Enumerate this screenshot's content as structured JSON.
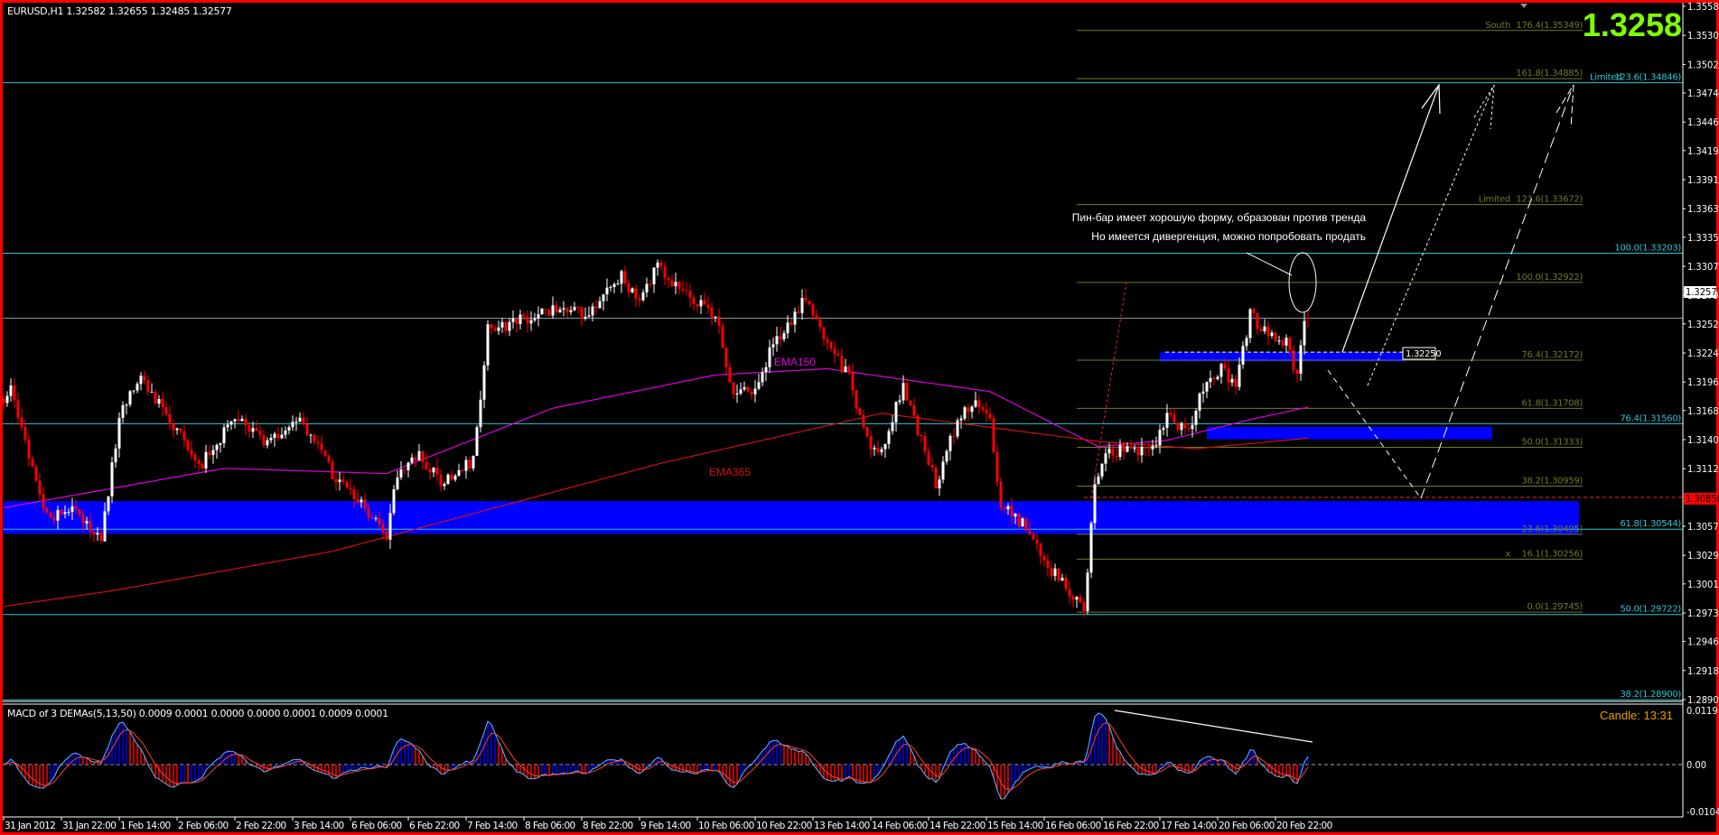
{
  "header": {
    "symbol_line": "EURUSD,H1  1.32582 1.32655 1.32485 1.32577",
    "big_price": "1.3258"
  },
  "indicator": {
    "macd_label": "MACD of 3 DEMAs(5,13,50) 0.0009 0.0001 0.0000 0.0000 0.0001 0.0009 0.0001",
    "candle_timer": "Candle:  13:31",
    "scale_labels": [
      "0.0119",
      "0.00",
      "-0.0104"
    ],
    "range": [
      -0.0104,
      0.0119
    ]
  },
  "annotation": {
    "line1": "Пин-бар имеет хорошую форму, образован против тренда",
    "line2": "Но имеется дивергенция, можно попробовать продать"
  },
  "labels": {
    "ema150": "EMA150",
    "ema365": "EMA365",
    "box_price": "1.32250",
    "current_price": "1.32577",
    "alert_price": "1.30850"
  },
  "colors": {
    "background": "#000000",
    "frame": "#ff0000",
    "bull": "#ffffff",
    "bear": "#ff0000",
    "zone": "#0000ff",
    "cyan": "#27c6d6",
    "fib": "#6b7b2b",
    "ema150": "#e000e0",
    "ema365": "#d01010",
    "big_price": "#7fff00",
    "timer": "#e8a000",
    "macd_line": "#5fb8ff",
    "signal_line": "#ff4030"
  },
  "chart_data": {
    "type": "candlestick",
    "title": "EURUSD,H1",
    "timeframe": "H1",
    "ylim": [
      1.28902,
      1.35582
    ],
    "y_ticks": [
      "1.35582",
      "1.35302",
      "1.35022",
      "1.34747",
      "1.34467",
      "1.34192",
      "1.33912",
      "1.33632",
      "1.33357",
      "1.33077",
      "1.32797",
      "1.32522",
      "1.32242",
      "1.31962",
      "1.31687",
      "1.31407",
      "1.31127",
      "1.30572",
      "1.30292",
      "1.30017",
      "1.29737",
      "1.29462",
      "1.29182",
      "1.28902"
    ],
    "x_ticks": [
      "31 Jan 2012",
      "31 Jan 22:00",
      "1 Feb 14:00",
      "2 Feb 06:00",
      "2 Feb 22:00",
      "3 Feb 14:00",
      "6 Feb 06:00",
      "6 Feb 22:00",
      "7 Feb 14:00",
      "8 Feb 06:00",
      "8 Feb 22:00",
      "9 Feb 14:00",
      "10 Feb 06:00",
      "10 Feb 22:00",
      "13 Feb 14:00",
      "14 Feb 06:00",
      "14 Feb 22:00",
      "15 Feb 14:00",
      "16 Feb 06:00",
      "16 Feb 22:00",
      "17 Feb 14:00",
      "20 Feb 06:00",
      "20 Feb 22:00"
    ],
    "bars_per_tick": 16,
    "close_path": [
      [
        0,
        1.318
      ],
      [
        2,
        1.3187
      ],
      [
        12,
        1.3065
      ],
      [
        18,
        1.3075
      ],
      [
        27,
        1.3044
      ],
      [
        32,
        1.3161
      ],
      [
        38,
        1.3203
      ],
      [
        46,
        1.3157
      ],
      [
        55,
        1.3118
      ],
      [
        64,
        1.3161
      ],
      [
        73,
        1.3135
      ],
      [
        82,
        1.3161
      ],
      [
        91,
        1.3108
      ],
      [
        100,
        1.3075
      ],
      [
        106,
        1.3044
      ],
      [
        109,
        1.311
      ],
      [
        115,
        1.3125
      ],
      [
        121,
        1.31
      ],
      [
        130,
        1.312
      ],
      [
        134,
        1.3246
      ],
      [
        143,
        1.3256
      ],
      [
        152,
        1.3267
      ],
      [
        161,
        1.3262
      ],
      [
        171,
        1.3299
      ],
      [
        176,
        1.327
      ],
      [
        181,
        1.331
      ],
      [
        188,
        1.328
      ],
      [
        197,
        1.3262
      ],
      [
        202,
        1.3182
      ],
      [
        209,
        1.319
      ],
      [
        212,
        1.3225
      ],
      [
        222,
        1.3277
      ],
      [
        228,
        1.3235
      ],
      [
        234,
        1.32
      ],
      [
        240,
        1.3128
      ],
      [
        244,
        1.314
      ],
      [
        249,
        1.3193
      ],
      [
        255,
        1.313
      ],
      [
        258,
        1.3097
      ],
      [
        264,
        1.316
      ],
      [
        269,
        1.318
      ],
      [
        273,
        1.316
      ],
      [
        276,
        1.3076
      ],
      [
        282,
        1.306
      ],
      [
        288,
        1.3023
      ],
      [
        296,
        1.299
      ],
      [
        299,
        1.2975
      ],
      [
        302,
        1.3097
      ],
      [
        305,
        1.3128
      ],
      [
        313,
        1.3132
      ],
      [
        317,
        1.3128
      ],
      [
        322,
        1.3161
      ],
      [
        328,
        1.315
      ],
      [
        332,
        1.3193
      ],
      [
        337,
        1.321
      ],
      [
        341,
        1.319
      ],
      [
        345,
        1.3261
      ],
      [
        349,
        1.3245
      ],
      [
        355,
        1.3235
      ],
      [
        358,
        1.3203
      ],
      [
        360,
        1.325
      ],
      [
        361,
        1.32577
      ]
    ],
    "last_ohlc": {
      "open": 1.32582,
      "high": 1.32655,
      "low": 1.32485,
      "close": 1.32577
    },
    "ema150_path": [
      [
        0,
        1.3075
      ],
      [
        61,
        1.3113
      ],
      [
        106,
        1.3108
      ],
      [
        152,
        1.3171
      ],
      [
        197,
        1.3203
      ],
      [
        228,
        1.3209
      ],
      [
        273,
        1.3187
      ],
      [
        303,
        1.3134
      ],
      [
        322,
        1.314
      ],
      [
        345,
        1.316
      ],
      [
        361,
        1.3172
      ]
    ],
    "ema365_path": [
      [
        0,
        1.298
      ],
      [
        30,
        1.2995
      ],
      [
        91,
        1.3033
      ],
      [
        182,
        1.3118
      ],
      [
        243,
        1.3166
      ],
      [
        303,
        1.3139
      ],
      [
        330,
        1.3132
      ],
      [
        361,
        1.3142
      ]
    ],
    "horizontal_lines": [
      {
        "price": 1.34846,
        "label": "123.6(1.34846)",
        "name": "Limited",
        "style": "cyan"
      },
      {
        "price": 1.33203,
        "label": "100.0(1.33203)",
        "name": "",
        "style": "cyan"
      },
      {
        "price": 1.3156,
        "label": "76.4(1.31560)",
        "name": "",
        "style": "cyan"
      },
      {
        "price": 1.30544,
        "label": "61.8(1.30544)",
        "name": "",
        "style": "cyan"
      },
      {
        "price": 1.29722,
        "label": "50.0(1.29722)",
        "name": "",
        "style": "cyan"
      },
      {
        "price": 1.289,
        "label": "38.2(1.28900)",
        "name": "",
        "style": "cyan"
      }
    ],
    "fib_levels": [
      {
        "price": 1.35349,
        "label": "176.4(1.35349)",
        "name": "South"
      },
      {
        "price": 1.34885,
        "label": "161.8(1.34885)",
        "name": ""
      },
      {
        "price": 1.33672,
        "label": "123.6(1.33672)",
        "name": "Limited"
      },
      {
        "price": 1.32922,
        "label": "100.0(1.32922)",
        "name": ""
      },
      {
        "price": 1.32172,
        "label": "76.4(1.32172)",
        "name": ""
      },
      {
        "price": 1.31708,
        "label": "61.8(1.31708)",
        "name": ""
      },
      {
        "price": 1.31333,
        "label": "50.0(1.31333)",
        "name": ""
      },
      {
        "price": 1.30959,
        "label": "38.2(1.30959)",
        "name": ""
      },
      {
        "price": 1.30495,
        "label": "23.6(1.30495)",
        "name": ""
      },
      {
        "price": 1.30256,
        "label": "16.1(1.30256)",
        "name": "x"
      },
      {
        "price": 1.29745,
        "label": "0.0(1.29745)",
        "name": ""
      }
    ],
    "fib_bar_range": [
      297,
      437
    ],
    "zones": [
      {
        "bars": [
          0,
          436
        ],
        "prices": [
          1.30499,
          1.30814
        ]
      },
      {
        "bars": [
          333,
          412
        ],
        "prices": [
          1.3141,
          1.3153
        ]
      },
      {
        "bars": [
          320,
          388
        ],
        "prices": [
          1.3216,
          1.3225
        ]
      }
    ],
    "current_price": 1.32577,
    "alert_price": 1.3085
  }
}
